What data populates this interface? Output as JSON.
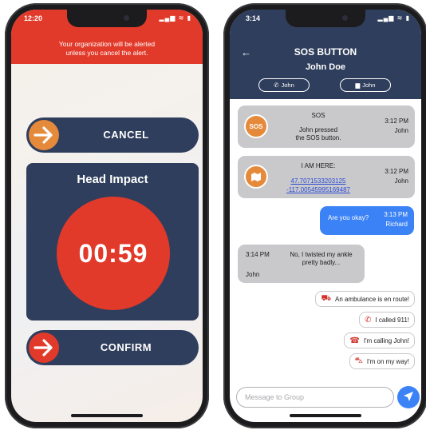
{
  "left_screen": {
    "status_time": "12:20",
    "status_icons": "▂▄▆ ≋ ▮",
    "alert_line1": "Your organization will be alerted",
    "alert_line2": "unless you cancel the alert.",
    "cancel_label": "CANCEL",
    "confirm_label": "CONFIRM",
    "impact_title": "Head Impact",
    "timer": "00:59",
    "colors": {
      "alert_red": "#e23a2a",
      "navy": "#2f3e5c",
      "orange": "#e58a3b"
    },
    "icons": {
      "arrow": "arrow-right-icon"
    }
  },
  "right_screen": {
    "status_time": "3:14",
    "status_icons": "▂▄▆ ≋ ▮",
    "title": "SOS BUTTON",
    "subtitle": "John Doe",
    "call_pill": "John",
    "chat_pill": "John",
    "messages": [
      {
        "badge": "SOS",
        "title": "SOS",
        "body_line1": "John pressed",
        "body_line2": "the SOS button.",
        "time": "3:12 PM",
        "sender": "John"
      },
      {
        "title": "I AM HERE:",
        "lat": "47.7071533203125",
        "lon": "-117.00545995169487",
        "time": "3:12 PM",
        "sender": "John"
      },
      {
        "text": "Are you okay?",
        "time": "3:13 PM",
        "sender": "Richard"
      },
      {
        "time": "3:14 PM",
        "text_line1": "No, I twisted my ankle",
        "text_line2": "pretty badly...",
        "sender": "John"
      }
    ],
    "quick_replies": [
      {
        "icon": "ambulance-icon",
        "text": "An ambulance is en route!"
      },
      {
        "icon": "phone-icon",
        "text": "I called 911!"
      },
      {
        "icon": "telephone-icon",
        "text": "I'm calling John!"
      },
      {
        "icon": "car-icon",
        "text": "I'm on my way!"
      }
    ],
    "compose_placeholder": "Message to Group",
    "colors": {
      "navy": "#2f3e5c",
      "blue": "#3b82f6",
      "gray_bubble": "#c9c9cc"
    }
  }
}
